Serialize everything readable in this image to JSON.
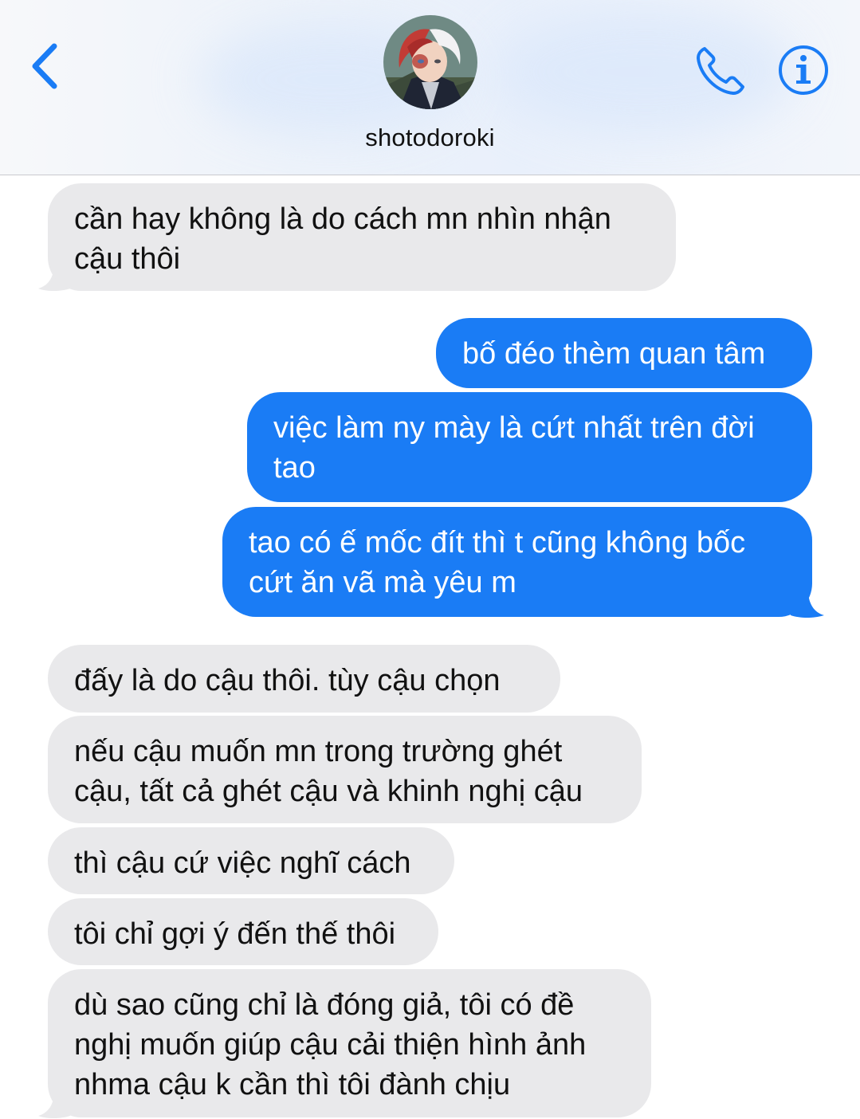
{
  "header": {
    "back_icon": "chevron-left-icon",
    "contact_name": "shotodoroki",
    "call_icon": "phone-icon",
    "info_icon": "info-icon",
    "accent_color": "#1a7cf5"
  },
  "messages": [
    {
      "direction": "incoming",
      "text": "cần hay không là do cách mn nhìn nhận\ncậu thôi"
    },
    {
      "direction": "outgoing",
      "text": "bố đéo thèm quan tâm"
    },
    {
      "direction": "outgoing",
      "text": "việc làm ny mày là cứt nhất trên đời\ntao"
    },
    {
      "direction": "outgoing",
      "text": "tao có ế mốc đít thì t cũng không bốc\ncứt ăn vã mà yêu m"
    },
    {
      "direction": "incoming",
      "text": "đấy là do cậu thôi. tùy cậu chọn"
    },
    {
      "direction": "incoming",
      "text": "nếu cậu muốn mn trong trường ghét\ncậu, tất cả ghét cậu và khinh nghị cậu"
    },
    {
      "direction": "incoming",
      "text": "thì cậu cứ việc nghĩ cách"
    },
    {
      "direction": "incoming",
      "text": "tôi chỉ gợi ý đến thế thôi"
    },
    {
      "direction": "incoming",
      "text": "dù sao cũng chỉ là đóng giả, tôi có đề\nnghị muốn giúp cậu cải thiện hình ảnh\nnhma cậu k cần thì tôi đành chịu"
    }
  ],
  "colors": {
    "incoming_bubble": "#e9e9eb",
    "outgoing_bubble": "#1a7cf5"
  }
}
